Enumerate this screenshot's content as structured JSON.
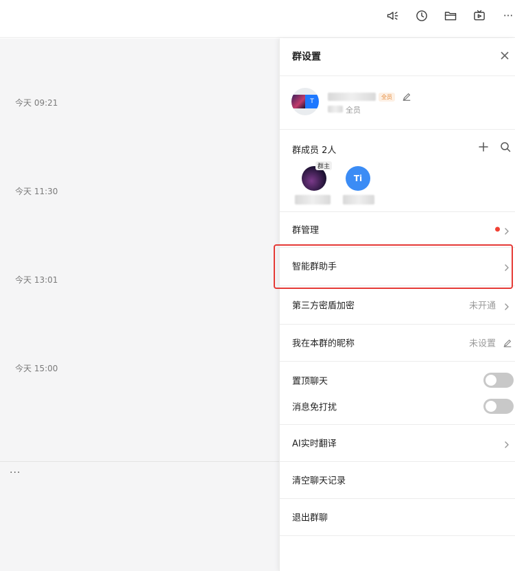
{
  "toolbar": {
    "icons": [
      "megaphone-icon",
      "history-icon",
      "folder-icon",
      "video-icon",
      "more-icon"
    ],
    "more_label": "···"
  },
  "chat": {
    "timestamps": [
      "今天 09:21",
      "今天 11:30",
      "今天 13:01",
      "今天 15:00"
    ],
    "input_more": "···"
  },
  "panel": {
    "title": "群设置",
    "group": {
      "avatar_letter": "T",
      "badge": "全员",
      "member_text": "全员"
    },
    "members": {
      "title": "群成员 2人",
      "owner_badge": "群主",
      "second_avatar_initials": "Ti"
    },
    "rows": {
      "group_manage": "群管理",
      "smart_assistant": "智能群助手",
      "third_party_encrypt": "第三方密盾加密",
      "third_party_encrypt_value": "未开通",
      "nickname": "我在本群的昵称",
      "nickname_value": "未设置",
      "pin_chat": "置顶聊天",
      "mute": "消息免打扰",
      "ai_translate": "AI实时翻译",
      "clear_history": "清空聊天记录",
      "leave_group": "退出群聊"
    },
    "toggles": {
      "pin_chat": false,
      "mute": false
    }
  },
  "colors": {
    "accent_red": "#e53935",
    "dot_red": "#f04134",
    "avatar_blue": "#3b8cf5"
  }
}
